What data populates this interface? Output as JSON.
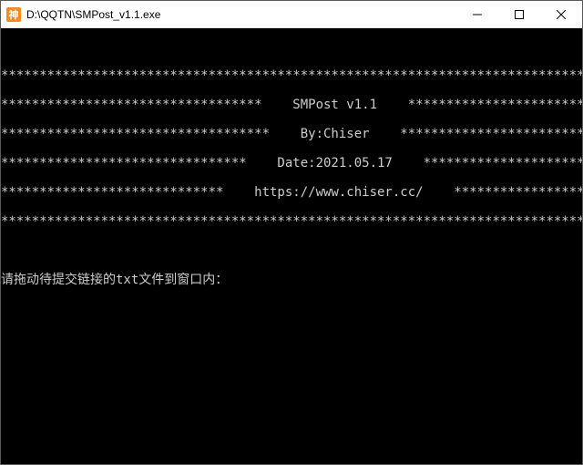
{
  "window": {
    "title": " D:\\QQTN\\SMPost_v1.1.exe",
    "icon_char": "神"
  },
  "banner": {
    "title": "SMPost v1.1",
    "author": "By:Chiser",
    "date": "Date:2021.05.17",
    "url": "https://www.chiser.cc/"
  },
  "prompt": "请拖动待提交链接的txt文件到窗口内："
}
